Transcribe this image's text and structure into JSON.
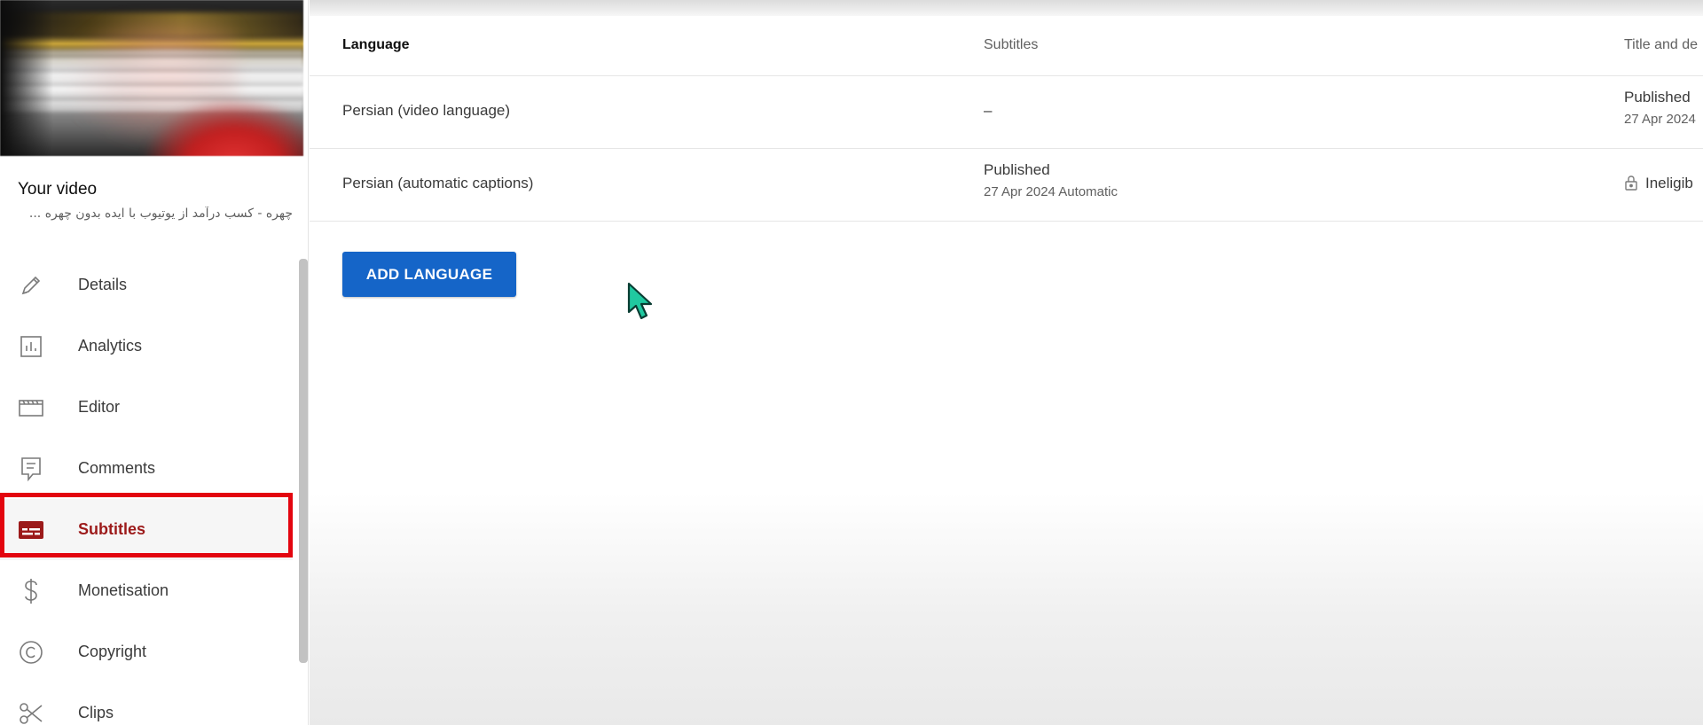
{
  "sidebar": {
    "video_label": "Your video",
    "video_title": "چهره - کسب درآمد از یوتیوب با ایده بدون چهره ...",
    "items": [
      {
        "label": "Details",
        "icon": "pencil-icon"
      },
      {
        "label": "Analytics",
        "icon": "analytics-icon"
      },
      {
        "label": "Editor",
        "icon": "editor-icon"
      },
      {
        "label": "Comments",
        "icon": "comments-icon"
      },
      {
        "label": "Subtitles",
        "icon": "subtitles-icon",
        "active": true
      },
      {
        "label": "Monetisation",
        "icon": "dollar-icon"
      },
      {
        "label": "Copyright",
        "icon": "copyright-icon"
      },
      {
        "label": "Clips",
        "icon": "scissors-icon"
      }
    ]
  },
  "table": {
    "headers": {
      "language": "Language",
      "subtitles": "Subtitles",
      "title_desc": "Title and de"
    },
    "rows": [
      {
        "language": "Persian (video language)",
        "subtitles": "–",
        "title_status": "Published",
        "title_date": "27 Apr 2024"
      },
      {
        "language": "Persian (automatic captions)",
        "subtitles_status": "Published",
        "subtitles_date": "27 Apr 2024 Automatic",
        "title_status": "Ineligib"
      }
    ]
  },
  "actions": {
    "add_language": "ADD LANGUAGE"
  },
  "colors": {
    "accent_blue": "#1565c8",
    "active_red_text": "#9c1a1a",
    "highlight_red": "#e3050f",
    "cursor_teal": "#20c9a0"
  }
}
